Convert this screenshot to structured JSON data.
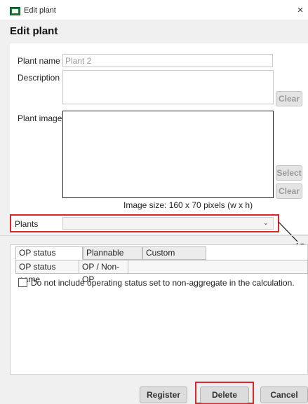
{
  "window": {
    "title": "Edit plant",
    "close_glyph": "×"
  },
  "page": {
    "heading": "Edit plant"
  },
  "form": {
    "plant_name_label": "Plant name",
    "plant_name_value": "Plant 2",
    "description_label": "Description",
    "description_value": "",
    "description_clear_label": "Clear",
    "plant_image_label": "Plant image",
    "image_select_label": "Select",
    "image_clear_label": "Clear",
    "image_size_hint": "Image size: 160 x 70 pixels (w x h)",
    "plants_label": "Plants",
    "plants_selected": "",
    "dropdown_icon": "chevron-down-icon"
  },
  "callout": {
    "text": "(O"
  },
  "tabs": [
    {
      "label": "OP status setting",
      "active": true
    },
    {
      "label": "Plannable time",
      "active": false
    },
    {
      "label": "Custom settings",
      "active": false
    }
  ],
  "table": {
    "columns": [
      "OP status name",
      "OP / Non-OP"
    ]
  },
  "checkbox": {
    "label": "Do not include operating status set to non-aggregate in the calculation.",
    "checked": false
  },
  "footer": {
    "register_label": "Register",
    "delete_label": "Delete",
    "cancel_label": "Cancel"
  },
  "colors": {
    "highlight": "#d9262c",
    "icon_green": "#1e7a3c"
  }
}
